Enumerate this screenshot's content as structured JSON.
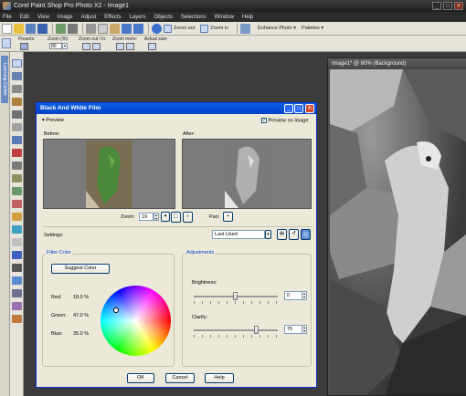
{
  "window": {
    "title": "Corel Paint Shop Pro Photo X2 - Image1"
  },
  "menu": [
    "File",
    "Edit",
    "View",
    "Image",
    "Adjust",
    "Effects",
    "Layers",
    "Objects",
    "Selections",
    "Window",
    "Help"
  ],
  "toolbar": {
    "zoom_out": "Zoom out",
    "zoom_in": "Zoom in",
    "enhance_photo": "Enhance Photo",
    "palettes": "Palettes"
  },
  "options_bar": {
    "presets_label": "Presets:",
    "zoom_pct_label": "Zoom (%):",
    "zoom_out_in_label": "Zoom out / in:",
    "zoom_more_label": "Zoom more:",
    "actual_size_label": "Actual size:",
    "zoom_value": "80"
  },
  "left_panel_tab": "Learning Center",
  "image_window": {
    "title": "Image1* @ 80% (Background)"
  },
  "dialog": {
    "title": "Black And White Film",
    "preview_toggle": "Preview",
    "preview_on_image": "Preview on Image",
    "before_label": "Before:",
    "after_label": "After:",
    "zoom_label": "Zoom:",
    "zoom_value": "19",
    "pan_label": "Pan:",
    "settings_label": "Settings:",
    "settings_value": "Last Used",
    "filter_color_title": "Filter Color",
    "suggest_color": "Suggest Color",
    "red_label": "Red:",
    "red_value": "18.0 %",
    "green_label": "Green:",
    "green_value": "47.0 %",
    "blue_label": "Blue:",
    "blue_value": "35.0 %",
    "adjustments_title": "Adjustments",
    "brightness_label": "Brightness:",
    "brightness_value": "0",
    "clarify_label": "Clarify:",
    "clarify_value": "75",
    "ok": "OK",
    "cancel": "Cancel",
    "help": "Help"
  }
}
